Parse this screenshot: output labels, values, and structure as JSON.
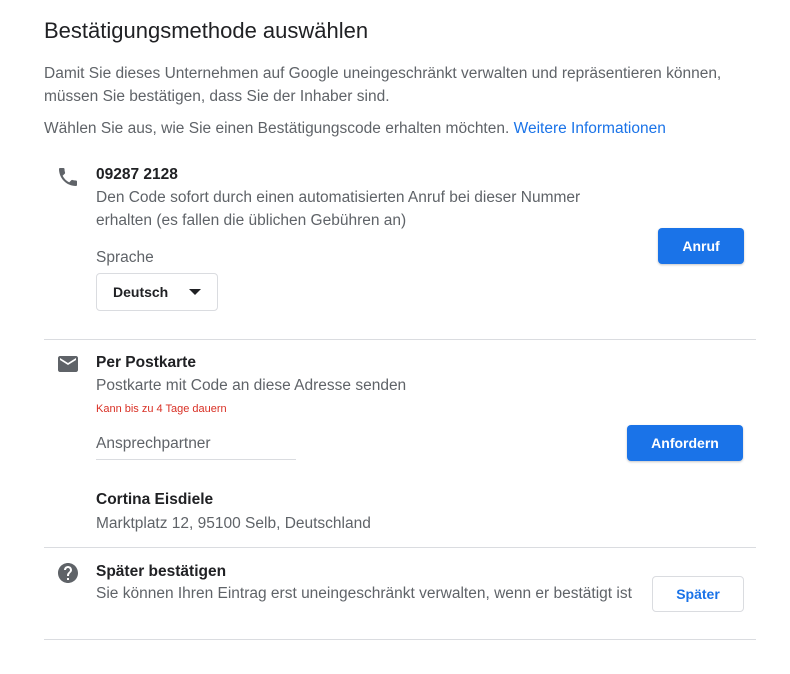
{
  "page": {
    "title": "Bestätigungsmethode auswählen",
    "intro": "Damit Sie dieses Unternehmen auf Google uneingeschränkt verwalten und repräsentieren können, müssen Sie bestätigen, dass Sie der Inhaber sind.",
    "choose_text": "Wählen Sie aus, wie Sie einen Bestätigungscode erhalten möchten.",
    "more_info_link": "Weitere Informationen"
  },
  "phone": {
    "number": "09287 2128",
    "description": "Den Code sofort durch einen automatisierten Anruf bei dieser Nummer erhalten (es fallen die üblichen Gebühren an)",
    "language_label": "Sprache",
    "language_value": "Deutsch",
    "button": "Anruf",
    "icon": "phone-icon"
  },
  "postcard": {
    "title": "Per Postkarte",
    "description": "Postkarte mit Code an diese Adresse senden",
    "note": "Kann bis zu 4 Tage dauern",
    "contact_placeholder": "Ansprechpartner",
    "button": "Anfordern",
    "business_name": "Cortina Eisdiele",
    "address": "Marktplatz 12, 95100 Selb, Deutschland",
    "icon": "mail-icon"
  },
  "later": {
    "title": "Später bestätigen",
    "description": "Sie können Ihren Eintrag erst uneingeschränkt verwalten, wenn er bestätigt ist",
    "button": "Später",
    "icon": "help-circle-icon"
  },
  "colors": {
    "primary": "#1a73e8",
    "text": "#202124",
    "secondary_text": "#5f6368",
    "icon": "#5f6368",
    "error": "#d93025",
    "divider": "#dadce0"
  }
}
